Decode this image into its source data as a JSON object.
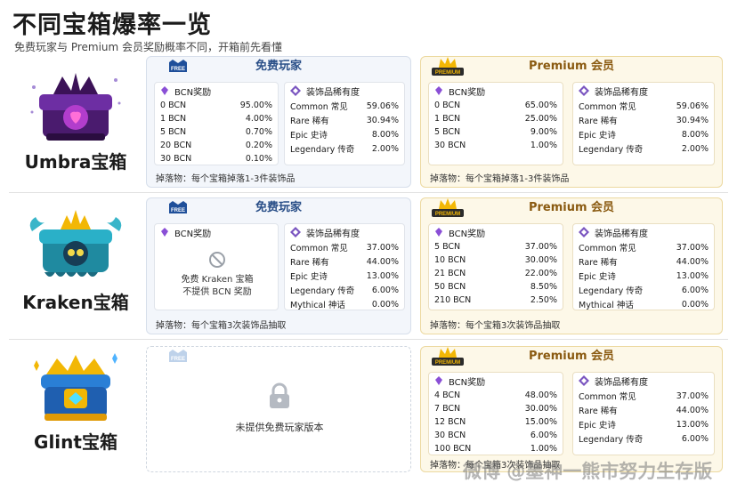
{
  "title": "不同宝箱爆率一览",
  "subtitle": "免费玩家与 Premium 会员奖励概率不同，开箱前先看懂",
  "free_badge": "FREE",
  "premium_badge": "PREMIUM",
  "free_header": "免费玩家",
  "premium_header": "Premium 会员",
  "bcn_header": "BCN奖励",
  "rarity_header": "装饰品稀有度",
  "colors": {
    "free_blue": "#2a4f88",
    "premium_gold": "#8a5a10",
    "premium_bg": "#fdf8e8",
    "free_bg": "#f3f6fb"
  },
  "chests": [
    {
      "name": "Umbra宝箱",
      "free": {
        "bcn": [
          [
            "0 BCN",
            "95.00%"
          ],
          [
            "1 BCN",
            "4.00%"
          ],
          [
            "5 BCN",
            "0.70%"
          ],
          [
            "20 BCN",
            "0.20%"
          ],
          [
            "30 BCN",
            "0.10%"
          ]
        ],
        "rarity": [
          [
            "Common 常见",
            "59.06%"
          ],
          [
            "Rare 稀有",
            "30.94%"
          ],
          [
            "Epic 史诗",
            "8.00%"
          ],
          [
            "Legendary 传奇",
            "2.00%"
          ]
        ],
        "drop": "掉落物：每个宝箱掉落1-3件装饰品"
      },
      "premium": {
        "bcn": [
          [
            "0 BCN",
            "65.00%"
          ],
          [
            "1 BCN",
            "25.00%"
          ],
          [
            "5 BCN",
            "9.00%"
          ],
          [
            "30 BCN",
            "1.00%"
          ]
        ],
        "rarity": [
          [
            "Common 常见",
            "59.06%"
          ],
          [
            "Rare 稀有",
            "30.94%"
          ],
          [
            "Epic 史诗",
            "8.00%"
          ],
          [
            "Legendary 传奇",
            "2.00%"
          ]
        ],
        "drop": "掉落物：每个宝箱掉落1-3件装饰品"
      }
    },
    {
      "name": "Kraken宝箱",
      "free": {
        "no_bcn_line1": "免费 Kraken 宝箱",
        "no_bcn_line2": "不提供 BCN 奖励",
        "rarity": [
          [
            "Common 常见",
            "37.00%"
          ],
          [
            "Rare 稀有",
            "44.00%"
          ],
          [
            "Epic 史诗",
            "13.00%"
          ],
          [
            "Legendary 传奇",
            "6.00%"
          ],
          [
            "Mythical 神话",
            "0.00%"
          ]
        ],
        "drop": "掉落物：每个宝箱3次装饰品抽取"
      },
      "premium": {
        "bcn": [
          [
            "5 BCN",
            "37.00%"
          ],
          [
            "10 BCN",
            "30.00%"
          ],
          [
            "21 BCN",
            "22.00%"
          ],
          [
            "50 BCN",
            "8.50%"
          ],
          [
            "210 BCN",
            "2.50%"
          ]
        ],
        "rarity": [
          [
            "Common 常见",
            "37.00%"
          ],
          [
            "Rare 稀有",
            "44.00%"
          ],
          [
            "Epic 史诗",
            "13.00%"
          ],
          [
            "Legendary 传奇",
            "6.00%"
          ],
          [
            "Mythical 神话",
            "0.00%"
          ]
        ],
        "drop": "掉落物：每个宝箱3次装饰品抽取"
      }
    },
    {
      "name": "Glint宝箱",
      "free": {
        "unavailable": "未提供免费玩家版本"
      },
      "premium": {
        "bcn": [
          [
            "4 BCN",
            "48.00%"
          ],
          [
            "7 BCN",
            "30.00%"
          ],
          [
            "12 BCN",
            "15.00%"
          ],
          [
            "30 BCN",
            "6.00%"
          ],
          [
            "100 BCN",
            "1.00%"
          ]
        ],
        "rarity": [
          [
            "Common 常见",
            "37.00%"
          ],
          [
            "Rare 稀有",
            "44.00%"
          ],
          [
            "Epic 史诗",
            "13.00%"
          ],
          [
            "Legendary 传奇",
            "6.00%"
          ]
        ],
        "drop": "掉落物：每个宝箱3次装饰品抽取"
      }
    }
  ],
  "watermark": "微博 @墨神一熊市努力生存版"
}
